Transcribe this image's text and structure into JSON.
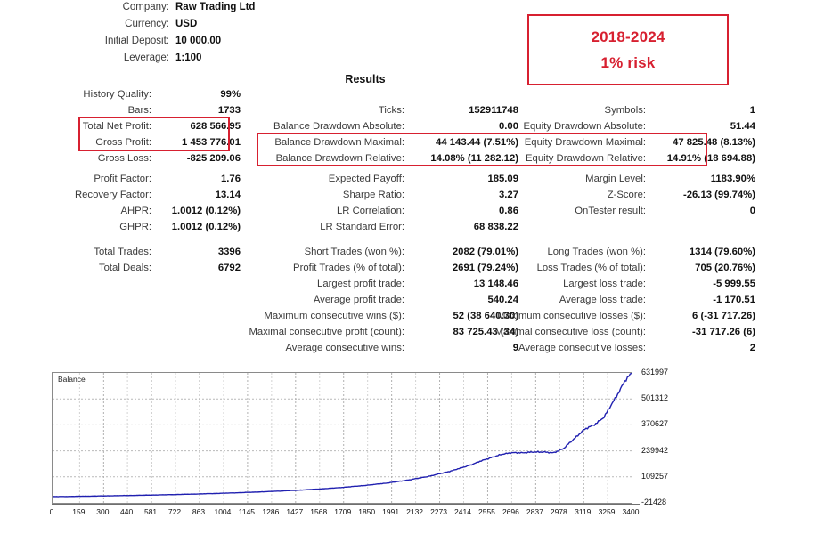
{
  "header": {
    "rows": [
      {
        "label": "Company:",
        "value": "Raw Trading Ltd"
      },
      {
        "label": "Currency:",
        "value": "USD"
      },
      {
        "label": "Initial Deposit:",
        "value": "10 000.00"
      },
      {
        "label": "Leverage:",
        "value": "1:100"
      }
    ]
  },
  "annotation": {
    "line1": "2018-2024",
    "line2": "1% risk",
    "color": "#d72030"
  },
  "results_title": "Results",
  "stats": {
    "group1": {
      "left": [
        {
          "label": "History Quality:",
          "value": "99%"
        },
        {
          "label": "Bars:",
          "value": "1733"
        },
        {
          "label": "Total Net Profit:",
          "value": "628 566.95"
        },
        {
          "label": "Gross Profit:",
          "value": "1 453 776.01"
        },
        {
          "label": "Gross Loss:",
          "value": "-825 209.06"
        }
      ],
      "mid": [
        {
          "label": "Ticks:",
          "value": "152911748"
        },
        {
          "label": "Balance Drawdown Absolute:",
          "value": "0.00"
        },
        {
          "label": "Balance Drawdown Maximal:",
          "value": "44 143.44 (7.51%)"
        },
        {
          "label": "Balance Drawdown Relative:",
          "value": "14.08% (11 282.12)"
        }
      ],
      "right": [
        {
          "label": "Symbols:",
          "value": "1"
        },
        {
          "label": "Equity Drawdown Absolute:",
          "value": "51.44"
        },
        {
          "label": "Equity Drawdown Maximal:",
          "value": "47 825.48 (8.13%)"
        },
        {
          "label": "Equity Drawdown Relative:",
          "value": "14.91% (18 694.88)"
        }
      ]
    },
    "group2": {
      "left": [
        {
          "label": "Profit Factor:",
          "value": "1.76"
        },
        {
          "label": "Recovery Factor:",
          "value": "13.14"
        },
        {
          "label": "AHPR:",
          "value": "1.0012 (0.12%)"
        },
        {
          "label": "GHPR:",
          "value": "1.0012 (0.12%)"
        }
      ],
      "mid": [
        {
          "label": "Expected Payoff:",
          "value": "185.09"
        },
        {
          "label": "Sharpe Ratio:",
          "value": "3.27"
        },
        {
          "label": "LR Correlation:",
          "value": "0.86"
        },
        {
          "label": "LR Standard Error:",
          "value": "68 838.22"
        }
      ],
      "right": [
        {
          "label": "Margin Level:",
          "value": "1183.90%"
        },
        {
          "label": "Z-Score:",
          "value": "-26.13 (99.74%)"
        },
        {
          "label": "OnTester result:",
          "value": "0"
        }
      ]
    },
    "group3": {
      "left": [
        {
          "label": "Total Trades:",
          "value": "3396"
        },
        {
          "label": "Total Deals:",
          "value": "6792"
        }
      ],
      "mid": [
        {
          "label": "Short Trades (won %):",
          "value": "2082 (79.01%)"
        },
        {
          "label": "Profit Trades (% of total):",
          "value": "2691 (79.24%)"
        },
        {
          "label": "Largest profit trade:",
          "value": "13 148.46"
        },
        {
          "label": "Average profit trade:",
          "value": "540.24"
        },
        {
          "label": "Maximum consecutive wins ($):",
          "value": "52 (38 640.30)"
        },
        {
          "label": "Maximal consecutive profit (count):",
          "value": "83 725.43 (34)"
        },
        {
          "label": "Average consecutive wins:",
          "value": "9"
        }
      ],
      "right": [
        {
          "label": "Long Trades (won %):",
          "value": "1314 (79.60%)"
        },
        {
          "label": "Loss Trades (% of total):",
          "value": "705 (20.76%)"
        },
        {
          "label": "Largest loss trade:",
          "value": "-5 999.55"
        },
        {
          "label": "Average loss trade:",
          "value": "-1 170.51"
        },
        {
          "label": "Maximum consecutive losses ($):",
          "value": "6 (-31 717.26)"
        },
        {
          "label": "Maximal consecutive loss (count):",
          "value": "-31 717.26 (6)"
        },
        {
          "label": "Average consecutive losses:",
          "value": "2"
        }
      ]
    }
  },
  "chart_data": {
    "type": "line",
    "title": "",
    "legend": "Balance",
    "legend_position": "top-left",
    "xlabel": "",
    "ylabel": "",
    "grid": true,
    "line_color": "#2020b0",
    "xlim": [
      0,
      3400
    ],
    "ylim": [
      -21428,
      631997
    ],
    "ytick_labels": [
      "631997",
      "501312",
      "370627",
      "239942",
      "109257",
      "-21428"
    ],
    "yticks": [
      631997,
      501312,
      370627,
      239942,
      109257,
      -21428
    ],
    "xtick_labels": [
      "0",
      "159",
      "300",
      "440",
      "581",
      "722",
      "863",
      "1004",
      "1145",
      "1286",
      "1427",
      "1568",
      "1709",
      "1850",
      "1991",
      "2132",
      "2273",
      "2414",
      "2555",
      "2696",
      "2837",
      "2978",
      "3119",
      "3259",
      "3400"
    ],
    "xticks": [
      0,
      159,
      300,
      440,
      581,
      722,
      863,
      1004,
      1145,
      1286,
      1427,
      1568,
      1709,
      1850,
      1991,
      2132,
      2273,
      2414,
      2555,
      2696,
      2837,
      2978,
      3119,
      3259,
      3400
    ],
    "series": [
      {
        "name": "Balance",
        "x": [
          0,
          60,
          120,
          180,
          240,
          300,
          360,
          420,
          480,
          540,
          600,
          660,
          720,
          780,
          840,
          900,
          960,
          1020,
          1080,
          1140,
          1200,
          1260,
          1320,
          1380,
          1440,
          1500,
          1560,
          1620,
          1680,
          1740,
          1800,
          1860,
          1920,
          1980,
          2040,
          2100,
          2160,
          2220,
          2280,
          2340,
          2400,
          2460,
          2520,
          2580,
          2640,
          2700,
          2760,
          2820,
          2880,
          2940,
          3000,
          3060,
          3120,
          3180,
          3240,
          3270,
          3300,
          3330,
          3360,
          3400
        ],
        "y": [
          10000,
          10600,
          11200,
          12000,
          12800,
          13600,
          14500,
          15400,
          16300,
          17300,
          18300,
          19400,
          20600,
          21800,
          23100,
          24500,
          26000,
          27600,
          29300,
          31100,
          33000,
          35100,
          37300,
          39700,
          42300,
          45100,
          48100,
          51400,
          55000,
          59000,
          63500,
          68500,
          74000,
          80000,
          87000,
          95000,
          104000,
          114000,
          126000,
          139000,
          154000,
          171000,
          190000,
          208000,
          222000,
          232000,
          229000,
          235000,
          233000,
          231000,
          250000,
          300000,
          345000,
          372000,
          410000,
          455000,
          500000,
          545000,
          590000,
          628567
        ]
      }
    ]
  }
}
